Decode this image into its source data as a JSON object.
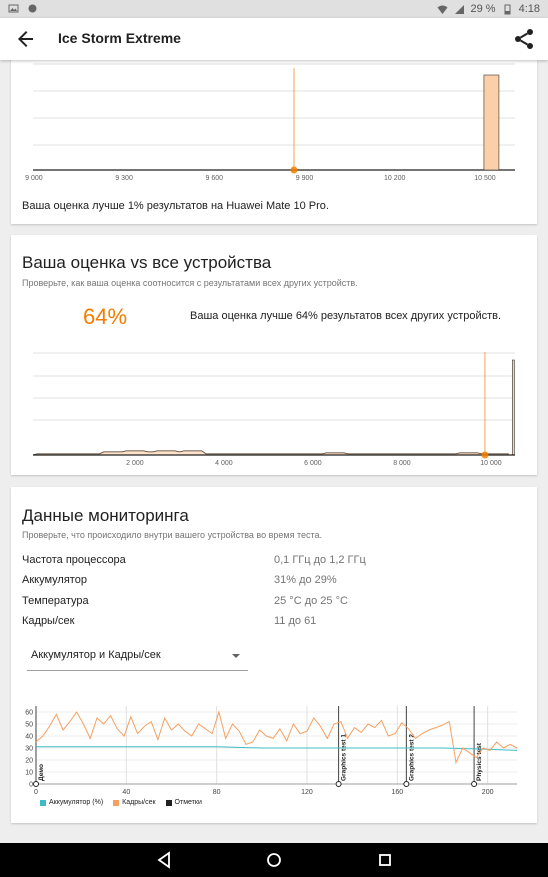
{
  "statusbar": {
    "battery": "29 %",
    "time": "4:18"
  },
  "appbar": {
    "title": "Ice Storm Extreme"
  },
  "card1": {
    "x_ticks": [
      "9 000",
      "9 300",
      "9 600",
      "9 900",
      "10 200",
      "10 500"
    ],
    "compare_text": "Ваша оценка лучше 1% результатов на Huawei Mate 10 Pro."
  },
  "card2": {
    "title": "Ваша оценка vs все устройства",
    "subtitle": "Проверьте, как ваша оценка соотносится с результатами всех других устройств.",
    "percent": "64%",
    "percent_text": "Ваша оценка лучше 64% результатов всех других устройств.",
    "x_ticks": [
      "2 000",
      "4 000",
      "6 000",
      "8 000",
      "10 000"
    ]
  },
  "card3": {
    "title": "Данные мониторинга",
    "subtitle": "Проверьте, что происходило внутри вашего устройства во время теста.",
    "rows": [
      {
        "key": "Частота процессора",
        "value": "0,1 ГГц до 1,2 ГГц"
      },
      {
        "key": "Аккумулятор",
        "value": "31% до 29%"
      },
      {
        "key": "Температура",
        "value": "25 °C до 25 °C"
      },
      {
        "key": "Кадры/сек",
        "value": "11 до 61"
      }
    ],
    "dropdown": "Аккумулятор и Кадры/сек",
    "legend": [
      "Аккумулятор (%)",
      "Кадры/сек",
      "Отметки"
    ],
    "markers": [
      "Демо",
      "Graphics test 1",
      "Graphics test 2",
      "Physics test"
    ]
  },
  "colors": {
    "accent": "#f57c00",
    "fps": "#f5a060",
    "battery": "#3fbcc7",
    "hist_fill": "#fbcfa8"
  },
  "chart_data": [
    {
      "type": "bar",
      "categories": [
        "9 000",
        "9 300",
        "9 600",
        "9 900",
        "10 200",
        "10 500"
      ],
      "values": [
        0,
        0,
        0,
        0,
        0,
        100
      ],
      "title": "",
      "xlabel": "",
      "ylabel": ""
    },
    {
      "type": "area",
      "x": [
        2000,
        4000,
        6000,
        8000,
        10000
      ],
      "title": "",
      "xlabel": "",
      "ylabel": ""
    },
    {
      "type": "line",
      "x_ticks": [
        0,
        40,
        80,
        120,
        160,
        200
      ],
      "y_ticks": [
        0,
        10,
        20,
        30,
        40,
        50,
        60
      ],
      "ylim": [
        0,
        65
      ],
      "xlim": [
        0,
        213
      ],
      "series": [
        {
          "name": "Аккумулятор (%)",
          "x": [
            0,
            20,
            40,
            60,
            80,
            100,
            120,
            140,
            160,
            180,
            200,
            213
          ],
          "values": [
            31,
            31,
            31,
            31,
            31,
            30,
            30,
            30,
            30,
            30,
            29,
            28
          ]
        },
        {
          "name": "Кадры/сек",
          "x": [
            0,
            3,
            6,
            9,
            12,
            15,
            18,
            21,
            24,
            27,
            30,
            33,
            36,
            39,
            42,
            45,
            48,
            51,
            54,
            57,
            60,
            63,
            66,
            69,
            72,
            75,
            78,
            81,
            84,
            87,
            90,
            93,
            96,
            99,
            102,
            105,
            108,
            111,
            114,
            117,
            120,
            123,
            126,
            129,
            132,
            135,
            138,
            141,
            144,
            147,
            150,
            153,
            156,
            159,
            162,
            165,
            168,
            171,
            174,
            177,
            180,
            183,
            186,
            189,
            192,
            195,
            198,
            201,
            204,
            207,
            210,
            213
          ],
          "values": [
            35,
            40,
            48,
            58,
            45,
            52,
            60,
            50,
            38,
            55,
            50,
            57,
            46,
            40,
            56,
            42,
            48,
            52,
            37,
            55,
            45,
            50,
            44,
            40,
            50,
            46,
            42,
            60,
            38,
            50,
            44,
            33,
            35,
            45,
            40,
            38,
            46,
            36,
            50,
            42,
            44,
            55,
            48,
            38,
            50,
            52,
            38,
            47,
            43,
            50,
            47,
            53,
            40,
            42,
            51,
            46,
            38,
            42,
            45,
            47,
            49,
            52,
            18,
            30,
            26,
            22,
            30,
            28,
            35,
            30,
            33,
            30
          ]
        }
      ],
      "markers": [
        {
          "label": "Демо",
          "x": 0
        },
        {
          "label": "Graphics test 1",
          "x": 134
        },
        {
          "label": "Graphics test 2",
          "x": 164
        },
        {
          "label": "Physics test",
          "x": 194
        }
      ]
    }
  ]
}
